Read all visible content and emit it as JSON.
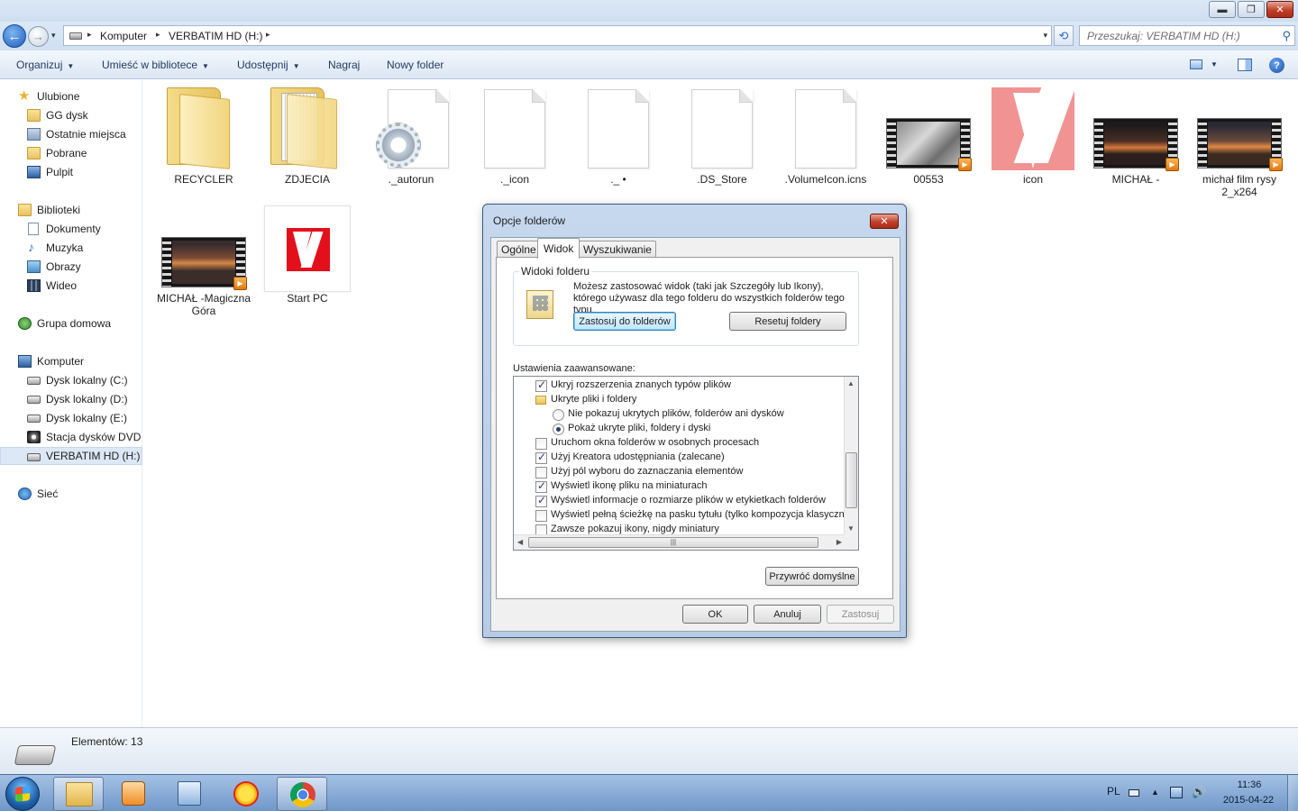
{
  "window": {
    "min_glyph": "▬",
    "max_glyph": "❐",
    "close_glyph": "✕"
  },
  "address": {
    "crumbs": [
      "Komputer",
      "VERBATIM HD (H:)"
    ],
    "separator": "▸",
    "dropdown": "▾",
    "back_glyph": "←",
    "fwd_glyph": "→",
    "recent_glyph": "▾",
    "refresh_glyph": "⟲"
  },
  "search": {
    "placeholder": "Przeszukaj: VERBATIM HD (H:)",
    "icon_glyph": "⚲"
  },
  "toolbar": {
    "organize": "Organizuj",
    "library": "Umieść w bibliotece",
    "share": "Udostępnij",
    "burn": "Nagraj",
    "new_folder": "Nowy folder",
    "arrow": "▼",
    "view_arrow": "▼",
    "help": "?"
  },
  "sidebar": {
    "favorites": {
      "label": "Ulubione",
      "items": [
        "GG dysk",
        "Ostatnie miejsca",
        "Pobrane",
        "Pulpit"
      ]
    },
    "libraries": {
      "label": "Biblioteki",
      "items": [
        "Dokumenty",
        "Muzyka",
        "Obrazy",
        "Wideo"
      ]
    },
    "homegroup": "Grupa domowa",
    "computer": {
      "label": "Komputer",
      "items": [
        "Dysk lokalny (C:)",
        "Dysk lokalny (D:)",
        "Dysk lokalny (E:)",
        "Stacja dysków DVD F",
        "VERBATIM HD (H:)"
      ]
    },
    "network": "Sieć"
  },
  "files": [
    {
      "name": "RECYCLER",
      "kind": "folder"
    },
    {
      "name": "ZDJECIA",
      "kind": "folder-full"
    },
    {
      "name": "._autorun",
      "kind": "settings"
    },
    {
      "name": "._icon",
      "kind": "blank"
    },
    {
      "name": "._ •",
      "kind": "blank"
    },
    {
      "name": ".DS_Store",
      "kind": "blank"
    },
    {
      "name": ".VolumeIcon.icns",
      "kind": "blank"
    },
    {
      "name": "00553",
      "kind": "video"
    },
    {
      "name": "icon",
      "kind": "v-logo"
    },
    {
      "name": "MICHAŁ -",
      "kind": "video"
    },
    {
      "name": "michał film rysy 2_x264",
      "kind": "video"
    },
    {
      "name": "MICHAŁ -Magiczna Góra",
      "kind": "video"
    },
    {
      "name": "Start PC",
      "kind": "startpc"
    }
  ],
  "status": {
    "count": "Elementów: 13"
  },
  "taskbar": {
    "lang": "PL",
    "tray_up": "▲",
    "volume": "🔊",
    "time": "11:36",
    "date": "2015-04-22"
  },
  "dialog": {
    "title": "Opcje folderów",
    "close_glyph": "✕",
    "tabs": [
      "Ogólne",
      "Widok",
      "Wyszukiwanie"
    ],
    "group_title": "Widoki folderu",
    "group_desc": "Możesz zastosować widok (taki jak Szczegóły lub Ikony), którego używasz dla tego folderu do wszystkich folderów tego typu.",
    "apply_folders": "Zastosuj do folderów",
    "reset_folders": "Resetuj foldery",
    "advanced_label": "Ustawienia zaawansowane:",
    "advanced": [
      {
        "type": "checkbox",
        "checked": true,
        "indent": 1,
        "label": "Ukryj rozszerzenia znanych typów plików"
      },
      {
        "type": "folder",
        "checked": false,
        "indent": 1,
        "label": "Ukryte pliki i foldery"
      },
      {
        "type": "radio",
        "checked": false,
        "indent": 2,
        "label": "Nie pokazuj ukrytych plików, folderów ani dysków"
      },
      {
        "type": "radio",
        "checked": true,
        "indent": 2,
        "label": "Pokaż ukryte pliki, foldery i dyski"
      },
      {
        "type": "checkbox",
        "checked": false,
        "indent": 1,
        "label": "Uruchom okna folderów w osobnych procesach"
      },
      {
        "type": "checkbox",
        "checked": true,
        "indent": 1,
        "label": "Użyj Kreatora udostępniania (zalecane)"
      },
      {
        "type": "checkbox",
        "checked": false,
        "indent": 1,
        "label": "Użyj pól wyboru do zaznaczania elementów"
      },
      {
        "type": "checkbox",
        "checked": true,
        "indent": 1,
        "label": "Wyświetl ikonę pliku na miniaturach"
      },
      {
        "type": "checkbox",
        "checked": true,
        "indent": 1,
        "label": "Wyświetl informacje o rozmiarze plików w etykietkach folderów"
      },
      {
        "type": "checkbox",
        "checked": false,
        "indent": 1,
        "label": "Wyświetl pełną ścieżkę na pasku tytułu (tylko kompozycja klasyczna)"
      },
      {
        "type": "checkbox",
        "checked": false,
        "indent": 1,
        "label": "Zawsze pokazuj ikony, nigdy miniatury"
      }
    ],
    "scroll": {
      "up": "▲",
      "down": "▼",
      "left": "◀",
      "right": "▶",
      "grip": "|||"
    },
    "restore_defaults": "Przywróć domyślne",
    "ok": "OK",
    "cancel": "Anuluj",
    "apply": "Zastosuj"
  }
}
